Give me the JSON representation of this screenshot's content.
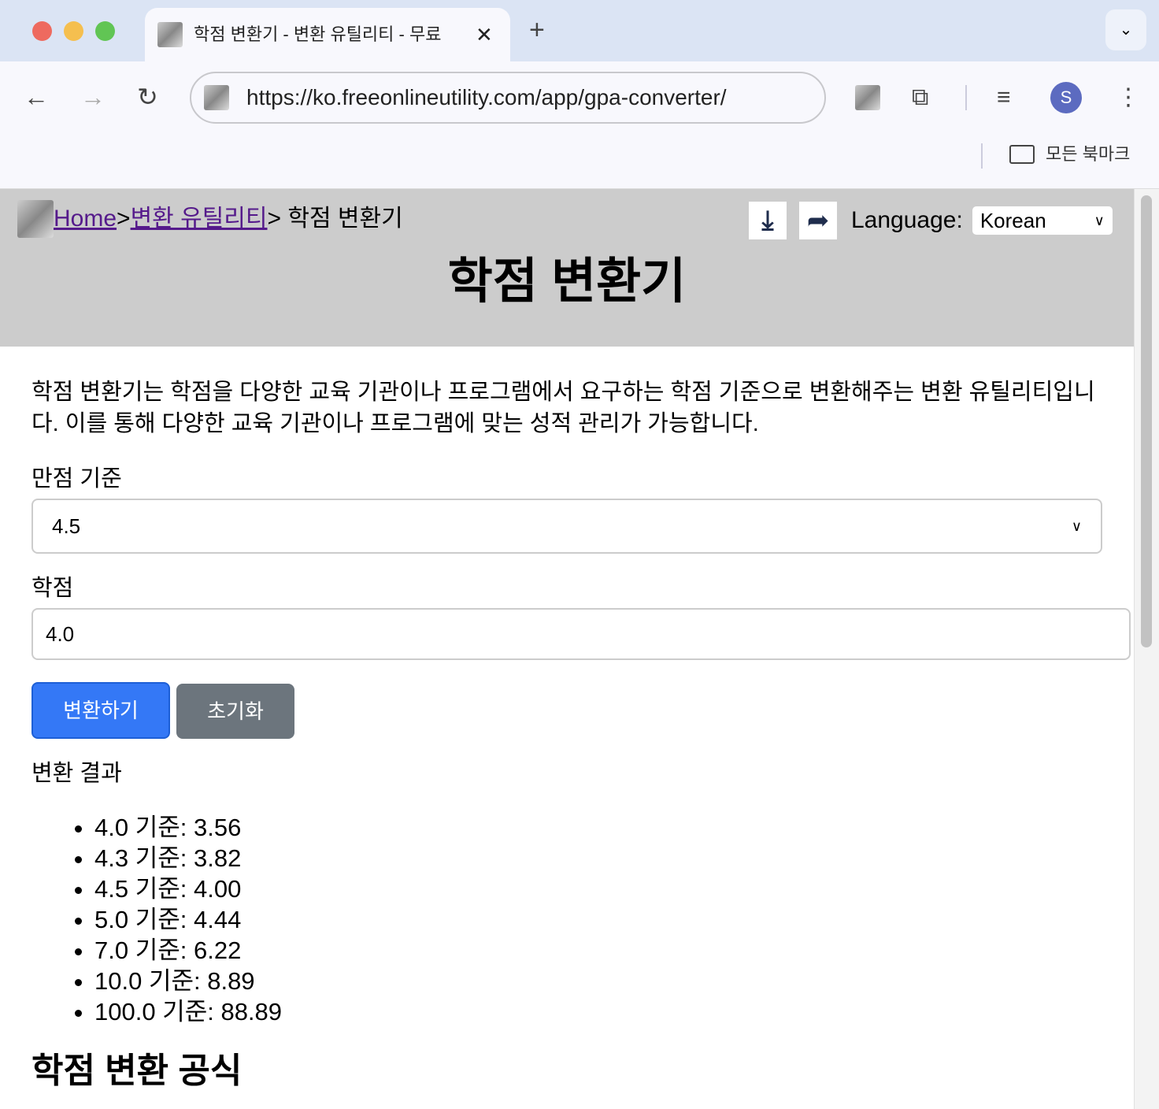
{
  "browser": {
    "tab_title": "학점 변환기 - 변환 유틸리티 - 무료",
    "url": "https://ko.freeonlineutility.com/app/gpa-converter/",
    "bookmarks_label": "모든 북마크",
    "avatar_letter": "S"
  },
  "header": {
    "breadcrumb": {
      "home": "Home",
      "sep1": ">",
      "category": "변환 유틸리티",
      "sep2": ">",
      "current": " 학점 변환기"
    },
    "language_label": "Language:",
    "language_value": "Korean",
    "title": "학점 변환기"
  },
  "main": {
    "description": "학점 변환기는 학점을 다양한 교육 기관이나 프로그램에서 요구하는 학점 기준으로 변환해주는 변환 유틸리티입니다. 이를 통해 다양한 교육 기관이나 프로그램에 맞는 성적 관리가 가능합니다.",
    "scale_label": "만점 기준",
    "scale_value": "4.5",
    "grade_label": "학점",
    "grade_value": "4.0",
    "convert_button": "변환하기",
    "reset_button": "초기화",
    "result_title": "변환 결과",
    "results": [
      "4.0 기준: 3.56",
      "4.3 기준: 3.82",
      "4.5 기준: 4.00",
      "5.0 기준: 4.44",
      "7.0 기준: 6.22",
      "10.0 기준: 8.89",
      "100.0 기준: 88.89"
    ],
    "formula_heading": "학점 변환 공식"
  },
  "colors": {
    "primary": "#3478f6",
    "secondary": "#6c757d",
    "header_bg": "#cccccc"
  }
}
